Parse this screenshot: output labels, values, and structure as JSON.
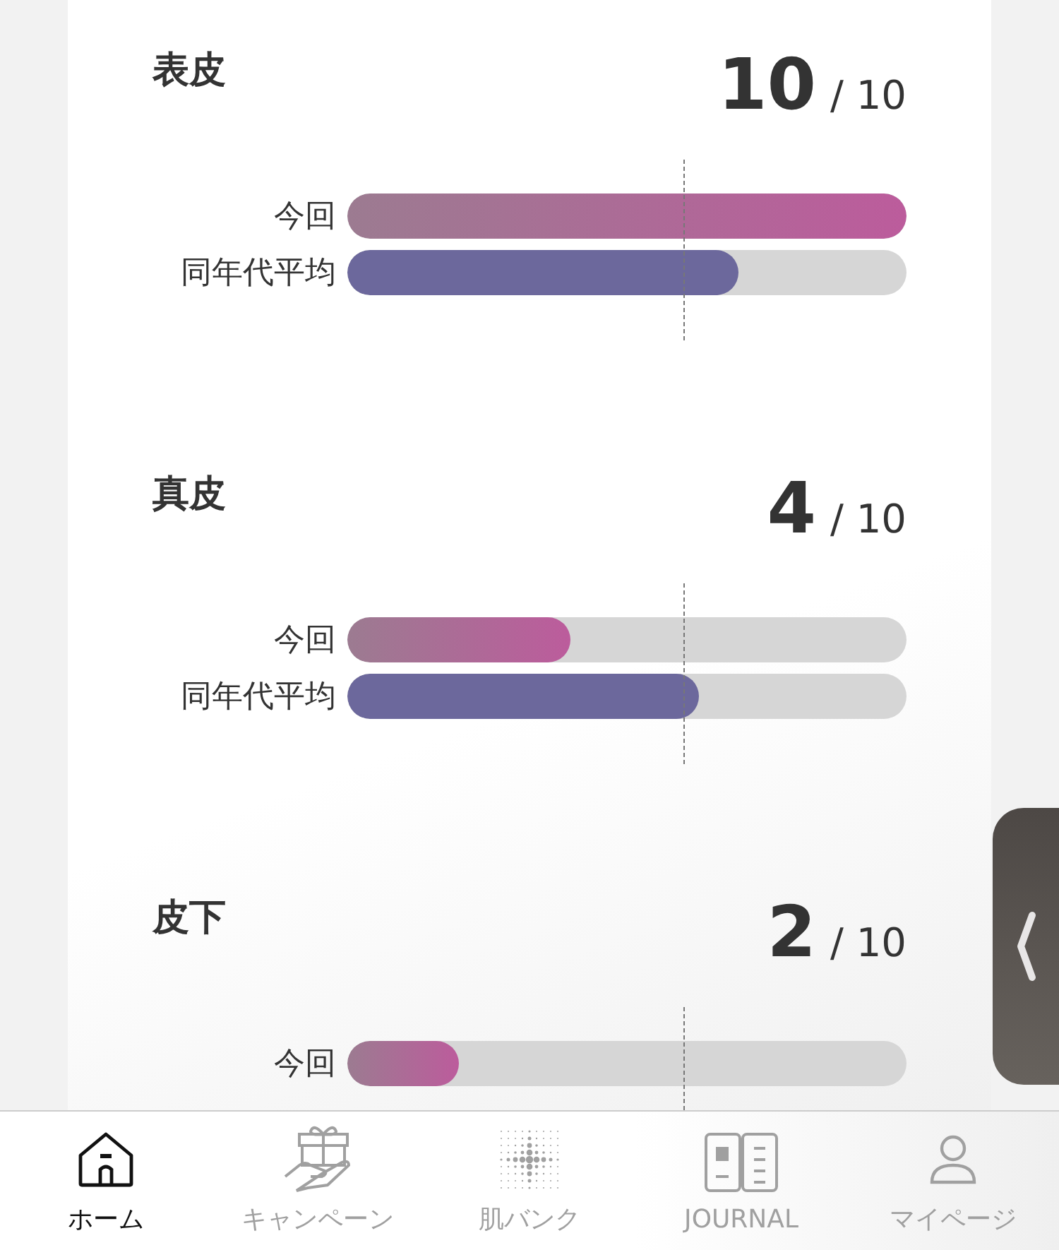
{
  "sections": [
    {
      "title": "表皮",
      "score": "10",
      "max": "/ 10",
      "bars": [
        {
          "label": "今回",
          "kind": "current",
          "level": 1.0
        },
        {
          "label": "同年代平均",
          "kind": "average",
          "level": 0.7
        }
      ]
    },
    {
      "title": "真皮",
      "score": "4",
      "max": "/ 10",
      "bars": [
        {
          "label": "今回",
          "kind": "current",
          "level": 0.4
        },
        {
          "label": "同年代平均",
          "kind": "average",
          "level": 0.63
        }
      ]
    },
    {
      "title": "皮下",
      "score": "2",
      "max": "/ 10",
      "bars": [
        {
          "label": "今回",
          "kind": "current",
          "level": 0.2
        }
      ]
    }
  ],
  "nav": [
    {
      "label": "ホーム",
      "kind": "home",
      "selected": true
    },
    {
      "label": "キャンペーン",
      "kind": "gift",
      "selected": false
    },
    {
      "label": "肌バンク",
      "kind": "dots",
      "selected": false
    },
    {
      "label": "JOURNAL",
      "kind": "book",
      "selected": false
    },
    {
      "label": "マイページ",
      "kind": "person",
      "selected": false
    }
  ]
}
